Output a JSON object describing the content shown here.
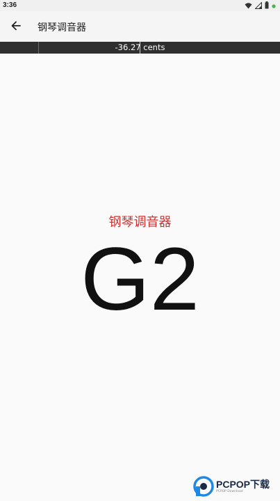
{
  "status_bar": {
    "time": "3:36",
    "icons": [
      "wifi-icon",
      "signal-icon",
      "battery-icon",
      "notification-dot-icon"
    ],
    "dot_color": "#4caf50"
  },
  "app_bar": {
    "back_icon": "arrow-back-icon",
    "title": "钢琴调音器"
  },
  "tuner": {
    "cents_text": "-36.27 cents",
    "cents_value": -36.27,
    "marker_color": "#e53935",
    "bar_color": "#2f2f2f"
  },
  "main": {
    "instrument_label": "钢琴调音器",
    "label_color": "#d32f2f",
    "note": "G2"
  },
  "watermark": {
    "logo_icon": "pcpop-logo-icon",
    "text": "PCPOP下载",
    "subtext": "PCPOP Download",
    "accent": "#1e88e5"
  }
}
